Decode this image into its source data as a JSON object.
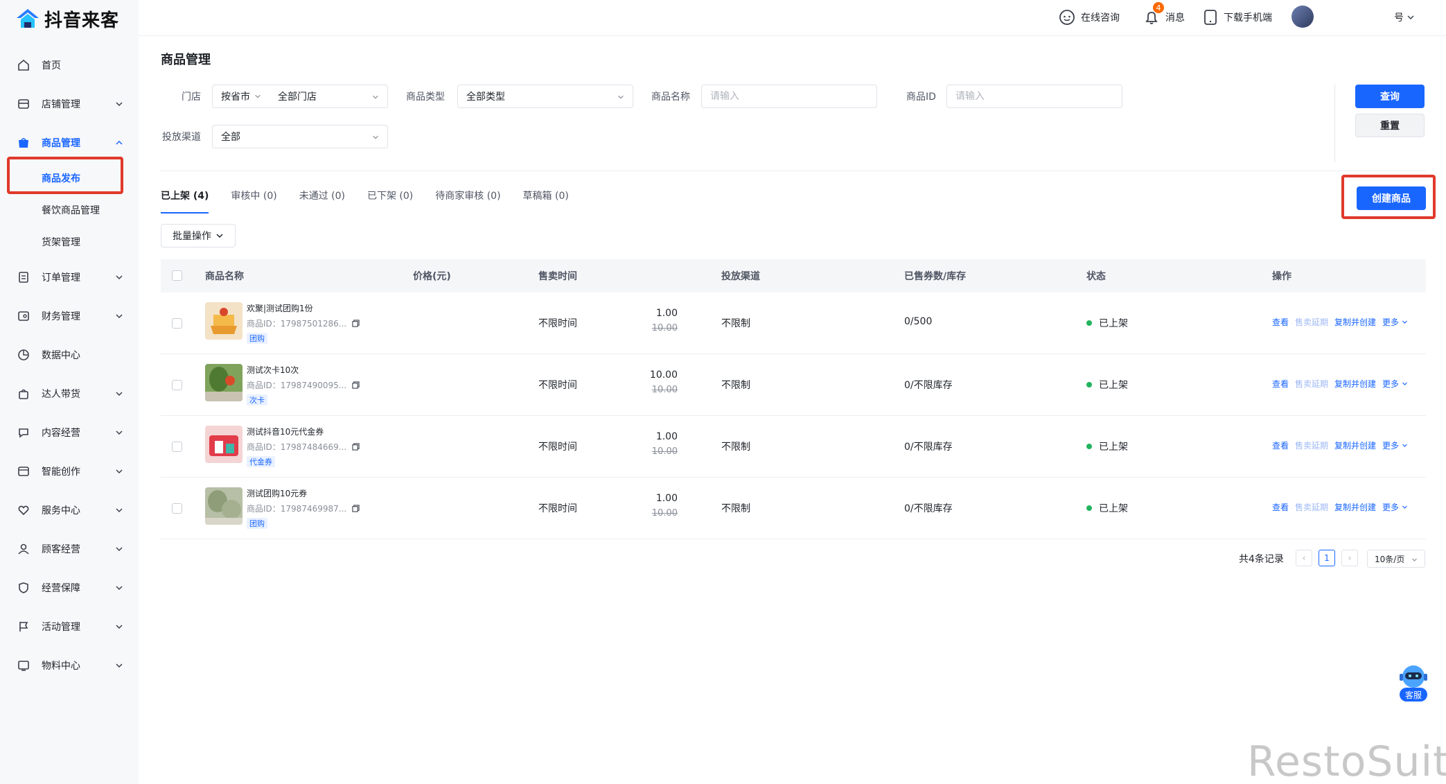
{
  "app": {
    "logo_text": "抖音来客"
  },
  "colors": {
    "accent": "#1966ff",
    "highlight": "#e0392b",
    "status_green": "#22b35e",
    "badge": "#ff6a00"
  },
  "sidebar": {
    "items": [
      {
        "label": "首页",
        "icon": "home-icon"
      },
      {
        "label": "店铺管理",
        "icon": "store-icon"
      },
      {
        "label": "商品管理",
        "icon": "goods-icon",
        "active": true,
        "children": [
          {
            "label": "商品发布",
            "active": true
          },
          {
            "label": "餐饮商品管理"
          },
          {
            "label": "货架管理"
          }
        ]
      },
      {
        "label": "订单管理",
        "icon": "order-icon"
      },
      {
        "label": "财务管理",
        "icon": "finance-icon"
      },
      {
        "label": "数据中心",
        "icon": "data-icon"
      },
      {
        "label": "达人带货",
        "icon": "bag-icon"
      },
      {
        "label": "内容经营",
        "icon": "content-icon"
      },
      {
        "label": "智能创作",
        "icon": "create-icon"
      },
      {
        "label": "服务中心",
        "icon": "service-icon"
      },
      {
        "label": "顾客经营",
        "icon": "customer-icon"
      },
      {
        "label": "经营保障",
        "icon": "shield-icon"
      },
      {
        "label": "活动管理",
        "icon": "flag-icon"
      },
      {
        "label": "物料中心",
        "icon": "material-icon"
      }
    ]
  },
  "header": {
    "consult": "在线咨询",
    "messages": "消息",
    "message_count": "4",
    "download": "下载手机端",
    "account_suffix": "号"
  },
  "page": {
    "title": "商品管理"
  },
  "filters": {
    "store_label": "门店",
    "store_region": "按省市",
    "store_value": "全部门店",
    "type_label": "商品类型",
    "type_value": "全部类型",
    "name_label": "商品名称",
    "name_placeholder": "请输入",
    "id_label": "商品ID",
    "id_placeholder": "请输入",
    "channel_label": "投放渠道",
    "channel_value": "全部",
    "query_button": "查询",
    "reset_button": "重置"
  },
  "create_button": "创建商品",
  "tabs": [
    {
      "label": "已上架 (4)",
      "active": true
    },
    {
      "label": "审核中 (0)"
    },
    {
      "label": "未通过 (0)"
    },
    {
      "label": "已下架 (0)"
    },
    {
      "label": "待商家审核 (0)"
    },
    {
      "label": "草稿箱 (0)"
    }
  ],
  "batch_button": "批量操作",
  "table": {
    "columns": [
      "商品名称",
      "价格(元)",
      "售卖时间",
      "投放渠道",
      "已售券数/库存",
      "状态",
      "操作"
    ],
    "rows": [
      {
        "name": "欢聚|测试团购1份",
        "id": "商品ID：17987501286...",
        "tag": "团购",
        "price": "1.00",
        "original_price": "10.00",
        "sale_time": "不限时间",
        "channel": "不限制",
        "stock": "0/500",
        "status": "已上架"
      },
      {
        "name": "测试次卡10次",
        "id": "商品ID：17987490095...",
        "tag": "次卡",
        "price": "10.00",
        "original_price": "10.00",
        "sale_time": "不限时间",
        "channel": "不限制",
        "stock": "0/不限库存",
        "status": "已上架"
      },
      {
        "name": "测试抖音10元代金券",
        "id": "商品ID：17987484669...",
        "tag": "代金券",
        "price": "1.00",
        "original_price": "10.00",
        "sale_time": "不限时间",
        "channel": "不限制",
        "stock": "0/不限库存",
        "status": "已上架"
      },
      {
        "name": "测试团购10元券",
        "id": "商品ID：17987469987...",
        "tag": "团购",
        "price": "1.00",
        "original_price": "10.00",
        "sale_time": "不限时间",
        "channel": "不限制",
        "stock": "0/不限库存",
        "status": "已上架"
      }
    ],
    "actions": {
      "view": "查看",
      "extend": "售卖延期",
      "copy": "复制并创建",
      "more": "更多"
    }
  },
  "pagination": {
    "total": "共4条记录",
    "current": "1",
    "page_size": "10条/页"
  },
  "service_widget": {
    "label": "客服"
  },
  "watermark": {
    "brand": "RestoSuite"
  }
}
